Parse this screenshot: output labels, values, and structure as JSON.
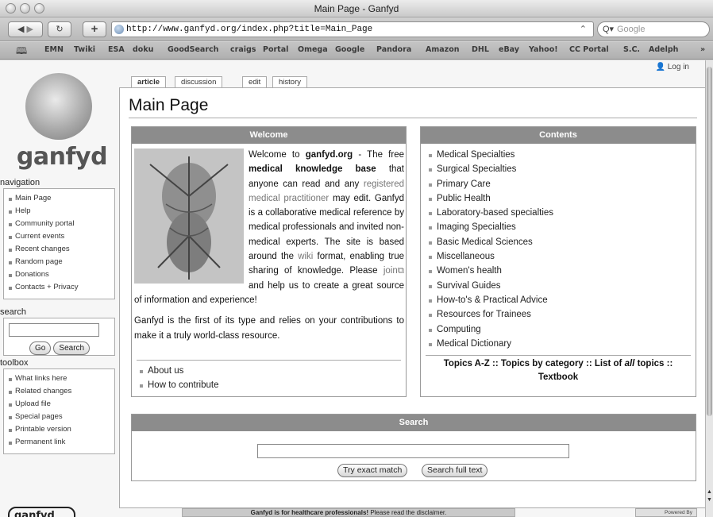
{
  "window": {
    "title": "Main Page - Ganfyd"
  },
  "toolbar": {
    "url": "http://www.ganfyd.org/index.php?title=Main_Page",
    "search_placeholder": "Google"
  },
  "bookmarks": [
    "EMN",
    "Twiki",
    "ESA",
    "doku",
    "GoodSearch",
    "craigs",
    "Portal",
    "Omega",
    "Google",
    "Pandora",
    "Amazon",
    "DHL",
    "eBay",
    "Yahoo!",
    "CC Portal",
    "S.C.",
    "Adelph",
    "»"
  ],
  "logo": {
    "text": "ganfyd"
  },
  "tabs": {
    "article": "article",
    "discussion": "discussion",
    "edit": "edit",
    "history": "history"
  },
  "login": "Log in",
  "page_title": "Main Page",
  "navigation": {
    "heading": "navigation",
    "items": [
      "Main Page",
      "Help",
      "Community portal",
      "Current events",
      "Recent changes",
      "Random page",
      "Donations",
      "Contacts + Privacy"
    ]
  },
  "search_portlet": {
    "heading": "search",
    "go": "Go",
    "search": "Search"
  },
  "toolbox": {
    "heading": "toolbox",
    "items": [
      "What links here",
      "Related changes",
      "Upload file",
      "Special pages",
      "Printable version",
      "Permanent link"
    ]
  },
  "welcome": {
    "heading": "Welcome",
    "t1": "Welcome to ",
    "site": "ganfyd.org",
    "t2": " - The free ",
    "mkb": "medical knowledge base",
    "t3": " that anyone can read and any ",
    "registered": "registered",
    "t4": " ",
    "medical_practitioner": "medical practitioner",
    "t5": " may edit. Ganfyd is a collaborative medical reference by medical professionals and invited non-medical experts. The site is based around the ",
    "wiki": "wiki",
    "t6": " format, enabling true sharing of knowledge. Please ",
    "join": "join",
    "t7": " and help us to create a great source of information and experience!",
    "p2": "Ganfyd is the first of its type and relies on your contributions to make it a truly world-class resource.",
    "links": [
      "About us",
      "How to contribute"
    ]
  },
  "contents": {
    "heading": "Contents",
    "items": [
      "Medical Specialties",
      "Surgical Specialties",
      "Primary Care",
      "Public Health",
      "Laboratory-based specialties",
      "Imaging Specialties",
      "Basic Medical Sciences",
      "Miscellaneous",
      "Women's health",
      "Survival Guides",
      "How-to's & Practical Advice",
      "Resources for Trainees",
      "Computing",
      "Medical Dictionary"
    ],
    "topics_a": "Topics A-Z :: Topics by category :: List of ",
    "topics_all": "all",
    "topics_b": " topics :: Textbook"
  },
  "search_box": {
    "heading": "Search",
    "exact": "Try exact match",
    "full": "Search full text"
  },
  "footer": {
    "logo": "ganfyd",
    "bold": "Ganfyd is for healthcare professionals!",
    "rest": " Please read the disclaimer.",
    "powered": "Powered By"
  }
}
